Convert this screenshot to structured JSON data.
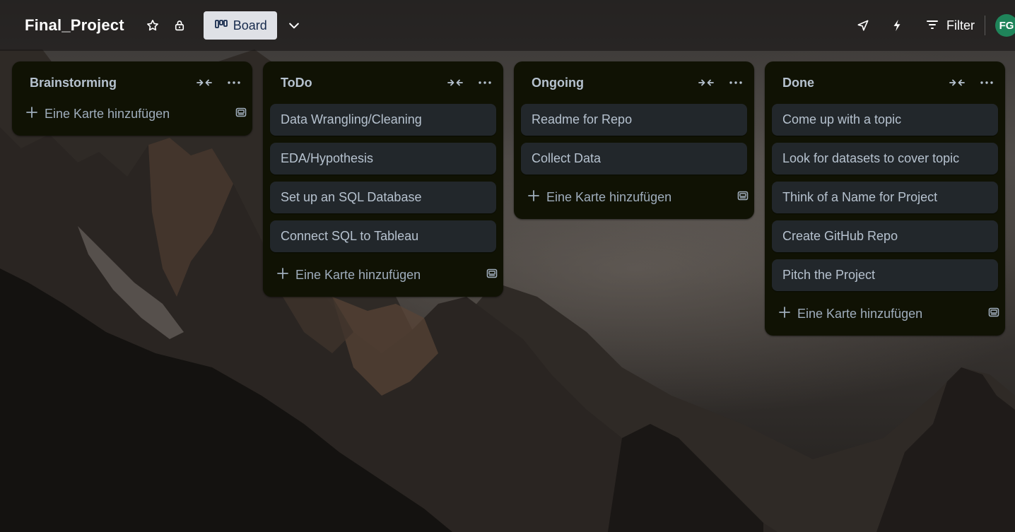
{
  "header": {
    "board_title": "Final_Project",
    "view_label": "Board",
    "filter_label": "Filter",
    "avatar_initials": "FG"
  },
  "icons": {
    "star": "star-icon",
    "visibility": "lock-icon",
    "board_view": "board-icon",
    "expand": "chevron-down-icon",
    "power_ups": "rocket-icon",
    "automation": "lightning-icon",
    "filter": "filter-icon",
    "collapse_list": "collapse-icon",
    "list_menu": "more-icon",
    "add": "plus-icon",
    "template": "card-template-icon"
  },
  "lists": [
    {
      "title": "Brainstorming",
      "cards": [],
      "add_label": "Eine Karte hinzufügen"
    },
    {
      "title": "ToDo",
      "cards": [
        "Data Wrangling/Cleaning",
        "EDA/Hypothesis",
        "Set up an SQL Database",
        "Connect SQL to Tableau"
      ],
      "add_label": "Eine Karte hinzufügen"
    },
    {
      "title": "Ongoing",
      "cards": [
        "Readme for Repo",
        "Collect Data"
      ],
      "add_label": "Eine Karte hinzufügen"
    },
    {
      "title": "Done",
      "cards": [
        "Come up with a topic",
        "Look for datasets to cover topic",
        "Think of a Name for Project",
        "Create GitHub Repo",
        "Pitch the Project"
      ],
      "add_label": "Eine Karte hinzufügen"
    }
  ],
  "colors": {
    "list_bg": "#101204",
    "card_bg": "#22272b",
    "text": "#b6c2cf",
    "avatar_bg": "#1f845a",
    "view_button_bg": "#dfe1e6"
  }
}
